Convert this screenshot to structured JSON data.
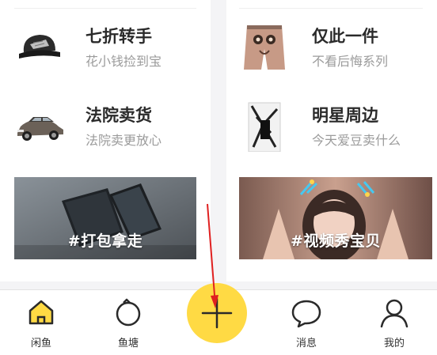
{
  "left_card": {
    "items": [
      {
        "title": "七折转手",
        "subtitle": "花小钱捡到宝",
        "thumb_icon": "cap-icon"
      },
      {
        "title": "法院卖货",
        "subtitle": "法院卖更放心",
        "thumb_icon": "car-icon"
      }
    ],
    "promo": {
      "text": "#打包拿走",
      "image_icon": "phones-photo"
    }
  },
  "right_card": {
    "items": [
      {
        "title": "仅此一件",
        "subtitle": "不看后悔系列",
        "thumb_icon": "shorts-icon"
      },
      {
        "title": "明星周边",
        "subtitle": "今天爱豆卖什么",
        "thumb_icon": "photo-frame-icon"
      }
    ],
    "promo": {
      "text": "#视频秀宝贝",
      "image_icon": "girl-photo"
    }
  },
  "tabbar": {
    "home": {
      "label": "闲鱼",
      "icon": "home-icon"
    },
    "pond": {
      "label": "鱼塘",
      "icon": "pond-icon"
    },
    "publish": {
      "icon": "plus-icon"
    },
    "messages": {
      "label": "消息",
      "icon": "chat-bubble-icon"
    },
    "mine": {
      "label": "我的",
      "icon": "person-icon"
    }
  },
  "colors": {
    "accent_yellow": "#ffda44",
    "annotation_red": "#e02020",
    "subtitle_gray": "#9b9b9b"
  }
}
